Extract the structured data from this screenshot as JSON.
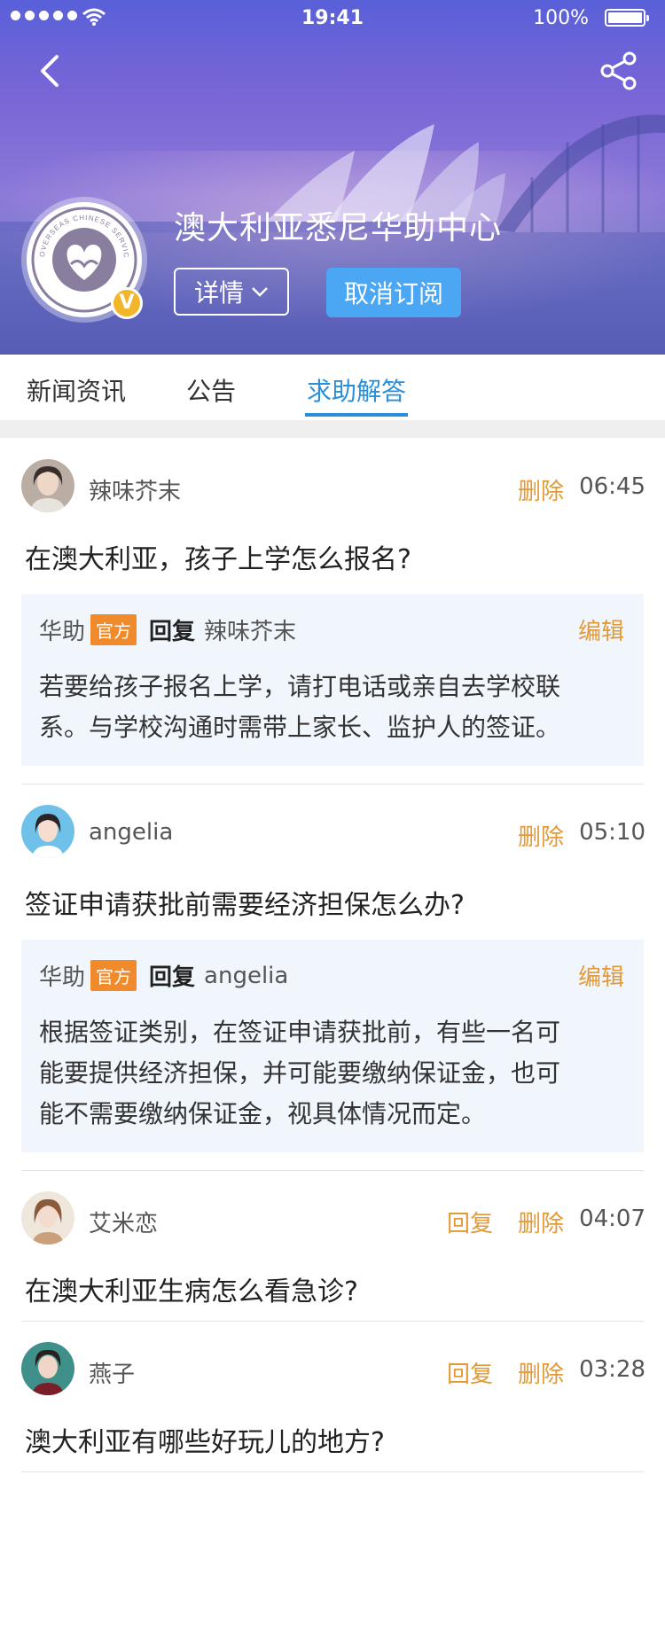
{
  "status_bar": {
    "time": "19:41",
    "battery": "100%"
  },
  "header": {
    "org_name": "澳大利亚悉尼华助中心",
    "detail_label": "详情",
    "unsubscribe_label": "取消订阅",
    "verified_mark": "V",
    "logo_text": "OVERSEAS CHINESE SERVICE CENTER"
  },
  "tabs": [
    {
      "label": "新闻资讯",
      "active": false
    },
    {
      "label": "公告",
      "active": false
    },
    {
      "label": "求助解答",
      "active": true
    }
  ],
  "posts": [
    {
      "user": "辣味芥末",
      "delete": "删除",
      "time": "06:45",
      "question": "在澳大利亚，孩子上学怎么报名?",
      "reply": {
        "author": "华助",
        "official_tag": "官方",
        "reply_word": "回复",
        "to_user": "辣味芥末",
        "edit": "编辑",
        "lines": [
          "若要给孩子报名上学，请打电话或亲自去学校联",
          "系。与学校沟通时需带上家长、监护人的签证。"
        ]
      }
    },
    {
      "user": "angelia",
      "delete": "删除",
      "time": "05:10",
      "question": "签证申请获批前需要经济担保怎么办?",
      "reply": {
        "author": "华助",
        "official_tag": "官方",
        "reply_word": "回复",
        "to_user": "angelia",
        "edit": "编辑",
        "lines": [
          "根据签证类别，在签证申请获批前，有些一名可",
          "能要提供经济担保，并可能要缴纳保证金，也可",
          "能不需要缴纳保证金，视具体情况而定。"
        ]
      }
    },
    {
      "user": "艾米恋",
      "reply_action": "回复",
      "delete": "删除",
      "time": "04:07",
      "question": "在澳大利亚生病怎么看急诊?"
    },
    {
      "user": "燕子",
      "reply_action": "回复",
      "delete": "删除",
      "time": "03:28",
      "question": "澳大利亚有哪些好玩儿的地方?"
    }
  ],
  "colors": {
    "accent_blue": "#2a8fd8",
    "action_orange": "#e39a36",
    "official_tag": "#f08a2b",
    "reply_bg": "#f0f6fc",
    "unsubscribe_bg": "#4ba6f3"
  }
}
